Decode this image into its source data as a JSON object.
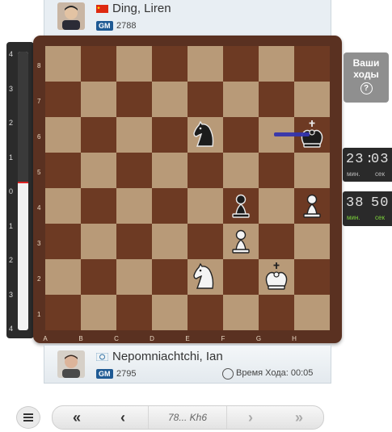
{
  "top_player": {
    "name": "Ding, Liren",
    "title": "GM",
    "rating": "2788",
    "flag_icon": "china-flag-icon"
  },
  "bottom_player": {
    "name": "Nepomniachtchi, Ian",
    "title": "GM",
    "rating": "2795",
    "flag_icon": "fide-flag-icon",
    "move_time_label": "Время Хода: 00:05"
  },
  "eval_bar": {
    "labels": [
      "4",
      "3",
      "2",
      "1",
      "0",
      "1",
      "2",
      "3",
      "4"
    ],
    "black_fraction": 0.47
  },
  "board": {
    "ranks": [
      "8",
      "7",
      "6",
      "5",
      "4",
      "3",
      "2",
      "1"
    ],
    "files": [
      "A",
      "B",
      "C",
      "D",
      "E",
      "F",
      "G",
      "H"
    ],
    "pieces": [
      {
        "square": "e6",
        "piece": "black-knight"
      },
      {
        "square": "h6",
        "piece": "black-king"
      },
      {
        "square": "f4",
        "piece": "black-pawn"
      },
      {
        "square": "h4",
        "piece": "white-pawn"
      },
      {
        "square": "f3",
        "piece": "white-pawn"
      },
      {
        "square": "e2",
        "piece": "white-knight"
      },
      {
        "square": "g2",
        "piece": "white-king"
      }
    ],
    "last_move_arrow": {
      "from": "g6",
      "to": "h6",
      "color": "#3434ad"
    }
  },
  "your_move": {
    "line1": "Ваши",
    "line2": "ходы",
    "icon": "?"
  },
  "clock_top": {
    "minutes": "23",
    "seconds": "03",
    "min_label": "мин.",
    "sec_label": "сек"
  },
  "clock_bottom": {
    "minutes": "38",
    "seconds": "50",
    "min_label": "мин.",
    "sec_label": "сек"
  },
  "nav": {
    "first": "«",
    "prev": "‹",
    "current_move": "78... Kh6",
    "next": "›",
    "last": "»"
  },
  "colors": {
    "light_square": "#b89a78",
    "dark_square": "#6d3a23",
    "frame": "#5a3121"
  }
}
